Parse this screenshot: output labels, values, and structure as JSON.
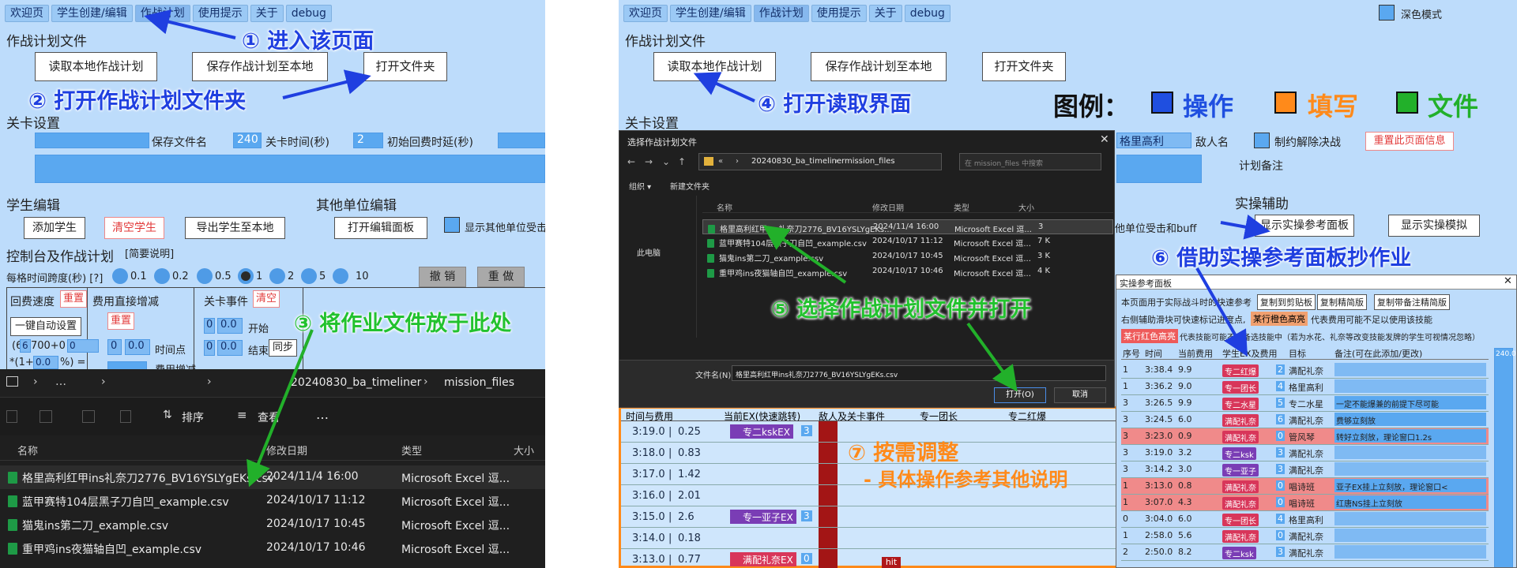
{
  "left": {
    "tabs": [
      "欢迎页",
      "学生创建/编辑",
      "作战计划",
      "使用提示",
      "关于",
      "debug"
    ],
    "plan_file_title": "作战计划文件",
    "buttons": {
      "read_local": "读取本地作战计划",
      "save_local": "保存作战计划至本地",
      "open_folder": "打开文件夹"
    },
    "stage_settings": "关卡设置",
    "save_filename": "保存文件名",
    "stage_time_value": "240",
    "stage_time_label": "关卡时间(秒)",
    "initial_cost_value": "2",
    "initial_cost_label": "初始回费时延(秒)",
    "student_edit": "学生编辑",
    "other_unit_edit": "其他单位编辑",
    "add_student": "添加学生",
    "clear_students": "清空学生",
    "export_students": "导出学生至本地",
    "open_edit_panel": "打开编辑面板",
    "show_other_units": "显示其他单位受击",
    "console_title": "控制台及作战计划",
    "brief_note": "[简要说明]",
    "time_span_label": "每格时间跨度(秒) [?]",
    "time_spans": [
      "0.1",
      "0.2",
      "0.5",
      "1",
      "2",
      "5",
      "10"
    ],
    "undo": "撤 销",
    "redo": "重 做",
    "regen_speed": "回费速度",
    "reset": "重置",
    "cost_direct": "费用直接增减",
    "stage_event": "关卡事件",
    "clear": "清空",
    "one_key_auto": "一键自动设置",
    "formula": "(6 *700+0",
    "formula_val1": "6",
    "formula_val2": "0",
    "formula2": "*(1+",
    "formula2_val": "0.0",
    "formula2_tail": "%) =",
    "reset2": "重置",
    "cost_zero": "0",
    "cost_zero2": "0.0",
    "time_point": "时间点",
    "cost_inc": "费用增减",
    "ev_zero": "0",
    "ev_zero2": "0.0",
    "ev_start": "开始",
    "ev_end": "结束",
    "ev_sync": "同步",
    "explorer": {
      "path": [
        "…",
        "20240830_ba_timeliner",
        "mission_files"
      ],
      "toolbar": {
        "sort": "排序",
        "view": "查看",
        "more": "…"
      },
      "headers": [
        "名称",
        "修改日期",
        "类型",
        "大小"
      ],
      "files": [
        {
          "name": "格里高利红甲ins礼奈刀2776_BV16YSLYgEKs.csv",
          "date": "2024/11/4 16:00",
          "type": "Microsoft Excel 逗..."
        },
        {
          "name": "蓝甲赛特104层黑子刀自凹_example.csv",
          "date": "2024/10/17 11:12",
          "type": "Microsoft Excel 逗..."
        },
        {
          "name": "猫鬼ins第二刀_example.csv",
          "date": "2024/10/17 10:45",
          "type": "Microsoft Excel 逗..."
        },
        {
          "name": "重甲鸡ins夜猫轴自凹_example.csv",
          "date": "2024/10/17 10:46",
          "type": "Microsoft Excel 逗..."
        }
      ]
    },
    "annotations": {
      "a1": "① 进入该页面",
      "a2": "② 打开作战计划文件夹",
      "a3": "③ 将作业文件放于此处"
    }
  },
  "right": {
    "tabs": [
      "欢迎页",
      "学生创建/编辑",
      "作战计划",
      "使用提示",
      "关于",
      "debug"
    ],
    "dark_mode": "深色模式",
    "plan_file_title": "作战计划文件",
    "buttons": {
      "read_local": "读取本地作战计划",
      "save_local": "保存作战计划至本地",
      "open_folder": "打开文件夹"
    },
    "stage_settings": "关卡设置",
    "legend": {
      "title": "图例：",
      "op": "操作",
      "fill": "填写",
      "file": "文件"
    },
    "enemy_value": "格里高利",
    "enemy_label": "敌人名",
    "restrict_label": "制约解除决战",
    "reset_page": "重置此页面信息",
    "plan_note": "计划备注",
    "practice_aid": "实操辅助",
    "buff_text": "他单位受击和buff",
    "show_ref_panel": "显示实操参考面板",
    "show_sim": "显示实操模拟",
    "annotations": {
      "a4": "④ 打开读取界面",
      "a5": "⑤ 选择作战计划文件并打开",
      "a6": "⑥ 借助实操参考面板抄作业",
      "a7": "⑦ 按需调整",
      "a7b": "- 具体操作参考其他说明"
    },
    "dialog": {
      "title": "选择作战计划文件",
      "path": [
        "«",
        "20240830_ba_timeliner",
        "mission_files"
      ],
      "search": "在 mission_files 中搜索",
      "organize": "组织 ▾",
      "new_folder": "新建文件夹",
      "headers": [
        "名称",
        "修改日期",
        "类型",
        "大小"
      ],
      "this_pc": "此电脑",
      "files": [
        {
          "name": "格里高利红甲ins礼奈刀2776_BV16YSLYgEKs...",
          "date": "2024/11/4 16:00",
          "type": "Microsoft Excel 逗...",
          "size": "3"
        },
        {
          "name": "蓝甲赛特104层黑子刀自凹_example.csv",
          "date": "2024/10/17 11:12",
          "type": "Microsoft Excel 逗...",
          "size": "7 K"
        },
        {
          "name": "猫鬼ins第二刀_example.csv",
          "date": "2024/10/17 10:45",
          "type": "Microsoft Excel 逗...",
          "size": "3 K"
        },
        {
          "name": "重甲鸡ins夜猫轴自凹_example.csv",
          "date": "2024/10/17 10:46",
          "type": "Microsoft Excel 逗...",
          "size": "4 K"
        }
      ],
      "filename_label": "文件名(N):",
      "filename_value": "格里高利红甲ins礼奈刀2776_BV16YSLYgEKs.csv",
      "open": "打开(O)",
      "cancel": "取消"
    },
    "timeline": {
      "headers": [
        "时间与费用",
        "当前EX(快速跳转)",
        "敌人及关卡事件",
        "专一团长",
        "专二红爆"
      ],
      "rows": [
        {
          "time": "3:19.0",
          "cost": "0.25",
          "chip": "专二kskEX",
          "num": "3"
        },
        {
          "time": "3:18.0",
          "cost": "0.83"
        },
        {
          "time": "3:17.0",
          "cost": "1.42"
        },
        {
          "time": "3:16.0",
          "cost": "2.01"
        },
        {
          "time": "3:15.0",
          "cost": "2.6",
          "chip": "专一亚子EX",
          "num": "3"
        },
        {
          "time": "3:14.0",
          "cost": "0.18"
        },
        {
          "time": "3:13.0",
          "cost": "0.77",
          "chip": "满配礼奈EX",
          "num": "0"
        }
      ],
      "hit": "hit"
    },
    "ref": {
      "title": "实操参考面板",
      "desc1": "本页面用于实际战斗时的快速参考",
      "copy_clip": "复制到剪贴板",
      "copy_brief": "复制精简版",
      "copy_notes": "复制带备注精简版",
      "desc2": "右侧辅助滑块可快速标记进度点,",
      "orange_tag": "某行橙色高亮",
      "desc2b": "代表费用可能不足以使用该技能",
      "red_tag": "某行红色高亮",
      "desc3": "代表技能可能不在备选技能中（若为水花、礼奈等改变技能发牌的学生可视情况忽略）",
      "headers": [
        "序号",
        "时间",
        "当前费用",
        "学生EX及费用",
        "目标",
        "备注(可在此添加/更改)"
      ],
      "side_value": "240.0",
      "rows": [
        {
          "n": "1",
          "t": "3:38.4",
          "c": "9.9",
          "s": "专二红爆",
          "sc": "2",
          "target": "满配礼奈",
          "note": "",
          "red": false
        },
        {
          "n": "1",
          "t": "3:36.2",
          "c": "9.0",
          "s": "专一团长",
          "sc": "4",
          "target": "格里高利",
          "note": "",
          "red": false
        },
        {
          "n": "3",
          "t": "3:26.5",
          "c": "9.9",
          "s": "专二水星",
          "sc": "5",
          "target": "专二水星",
          "note": "一定不能爆兼的前提下尽可能",
          "red": false
        },
        {
          "n": "3",
          "t": "3:24.5",
          "c": "6.0",
          "s": "满配礼奈",
          "sc": "6",
          "target": "满配礼奈",
          "note": "费够立刻放",
          "red": false
        },
        {
          "n": "3",
          "t": "3:23.0",
          "c": "0.9",
          "s": "满配礼奈",
          "sc": "0",
          "target": "管风琴",
          "note": "转好立刻放，理论窗口1.2s",
          "red": true
        },
        {
          "n": "3",
          "t": "3:19.0",
          "c": "3.2",
          "s": "专二ksk",
          "sc": "3",
          "target": "满配礼奈",
          "note": "",
          "red": false
        },
        {
          "n": "3",
          "t": "3:14.2",
          "c": "3.0",
          "s": "专一亚子",
          "sc": "3",
          "target": "满配礼奈",
          "note": "",
          "red": false
        },
        {
          "n": "1",
          "t": "3:13.0",
          "c": "0.8",
          "s": "满配礼奈",
          "sc": "0",
          "target": "唱诗班",
          "note": "亚子EX挂上立刻放，理论窗口<",
          "red": true
        },
        {
          "n": "1",
          "t": "3:07.0",
          "c": "4.3",
          "s": "满配礼奈",
          "sc": "0",
          "target": "唱诗班",
          "note": "红唐NS挂上立刻放",
          "red": true
        },
        {
          "n": "0",
          "t": "3:04.0",
          "c": "6.0",
          "s": "专一团长",
          "sc": "4",
          "target": "格里高利",
          "note": "",
          "red": false
        },
        {
          "n": "1",
          "t": "2:58.0",
          "c": "5.6",
          "s": "满配礼奈",
          "sc": "0",
          "target": "满配礼奈",
          "note": "",
          "red": false
        },
        {
          "n": "2",
          "t": "2:50.0",
          "c": "8.2",
          "s": "专二ksk",
          "sc": "3",
          "target": "满配礼奈",
          "note": "",
          "red": false
        }
      ]
    }
  }
}
